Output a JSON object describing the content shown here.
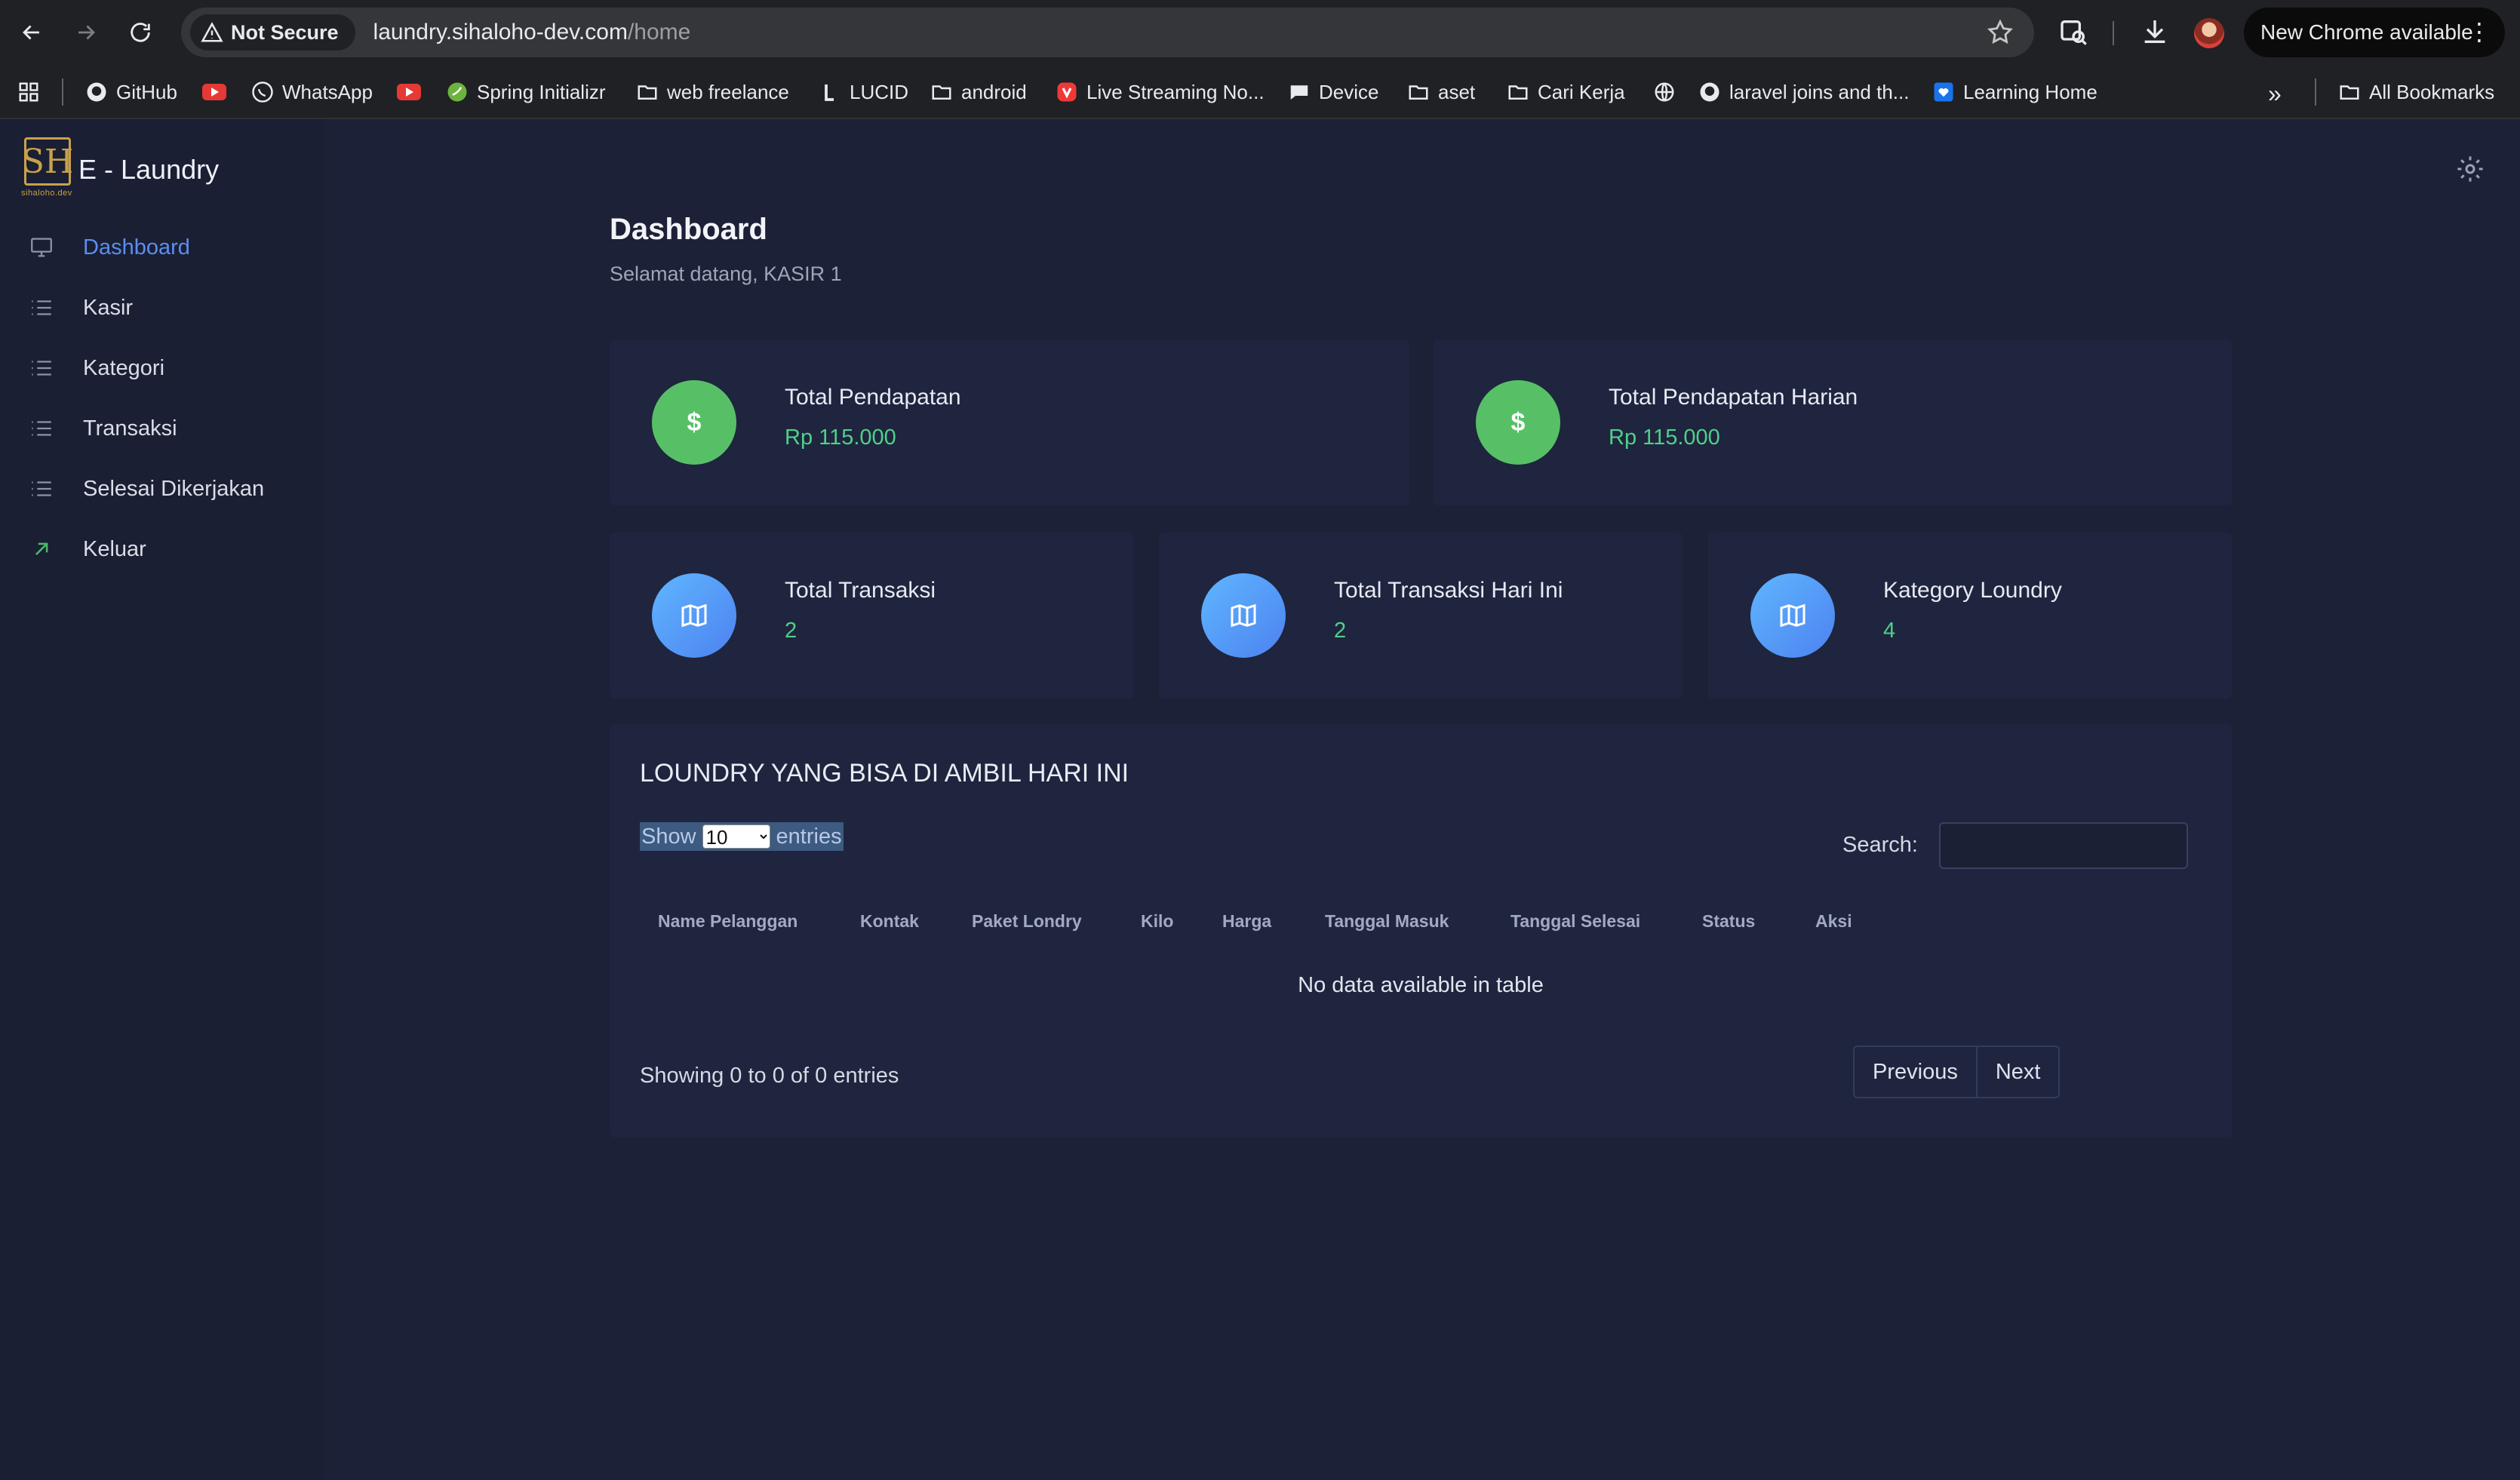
{
  "browser": {
    "security_label": "Not Secure",
    "url_host": "laundry.sihaloho-dev.com",
    "url_path": "/home",
    "update_label": "New Chrome available",
    "bookmarks": [
      {
        "label": "GitHub",
        "icon": "github-icon"
      },
      {
        "label": "",
        "icon": "youtube-icon"
      },
      {
        "label": "WhatsApp",
        "icon": "whatsapp-icon"
      },
      {
        "label": "",
        "icon": "youtube-icon"
      },
      {
        "label": "Spring Initializr",
        "icon": "spring-icon"
      },
      {
        "label": "web freelance",
        "icon": "folder-icon"
      },
      {
        "label": "LUCID",
        "icon": "lucid-icon"
      },
      {
        "label": "android",
        "icon": "folder-icon"
      },
      {
        "label": "Live Streaming No...",
        "icon": "vivaldi-icon"
      },
      {
        "label": "Device",
        "icon": "chat-icon"
      },
      {
        "label": "aset",
        "icon": "folder-icon"
      },
      {
        "label": "Cari Kerja",
        "icon": "folder-icon"
      },
      {
        "label": "",
        "icon": "globe-icon"
      },
      {
        "label": "laravel joins and th...",
        "icon": "github-icon"
      },
      {
        "label": "Learning Home",
        "icon": "learning-icon"
      }
    ],
    "overflow_label": "»",
    "all_bookmarks_label": "All Bookmarks"
  },
  "app": {
    "brand_name": "E - Laundry",
    "logo_text": "SH",
    "logo_sub": "sihaloho.dev",
    "menu": [
      {
        "label": "Dashboard",
        "icon": "monitor-icon",
        "active": true
      },
      {
        "label": "Kasir",
        "icon": "list-icon"
      },
      {
        "label": "Kategori",
        "icon": "list-icon"
      },
      {
        "label": "Transaksi",
        "icon": "list-icon"
      },
      {
        "label": "Selesai Dikerjakan",
        "icon": "list-icon"
      },
      {
        "label": "Keluar",
        "icon": "arrow-up-right-icon"
      }
    ]
  },
  "page": {
    "title": "Dashboard",
    "subtitle": "Selamat datang, KASIR 1"
  },
  "stats": [
    {
      "label": "Total Pendapatan",
      "value": "Rp 115.000",
      "icon": "dollar-icon"
    },
    {
      "label": "Total Pendapatan Harian",
      "value": "Rp 115.000",
      "icon": "dollar-icon"
    },
    {
      "label": "Total Transaksi",
      "value": "2",
      "icon": "map-icon"
    },
    {
      "label": "Total Transaksi Hari Ini",
      "value": "2",
      "icon": "map-icon"
    },
    {
      "label": "Kategory Loundry",
      "value": "4",
      "icon": "map-icon"
    }
  ],
  "table": {
    "title": "LOUNDRY YANG BISA DI AMBIL HARI INI",
    "show_label": "Show",
    "page_size": "10",
    "entries_label": "entries",
    "search_label": "Search:",
    "search_value": "",
    "columns": [
      "Name Pelanggan",
      "Kontak",
      "Paket Londry",
      "Kilo",
      "Harga",
      "Tanggal Masuk",
      "Tanggal Selesai",
      "Status",
      "Aksi"
    ],
    "empty_message": "No data available in table",
    "info": "Showing 0 to 0 of 0 entries",
    "prev_label": "Previous",
    "next_label": "Next"
  },
  "colors": {
    "accent": "#5b8ef0",
    "value_green": "#4fd08a",
    "background": "#1c2137"
  }
}
